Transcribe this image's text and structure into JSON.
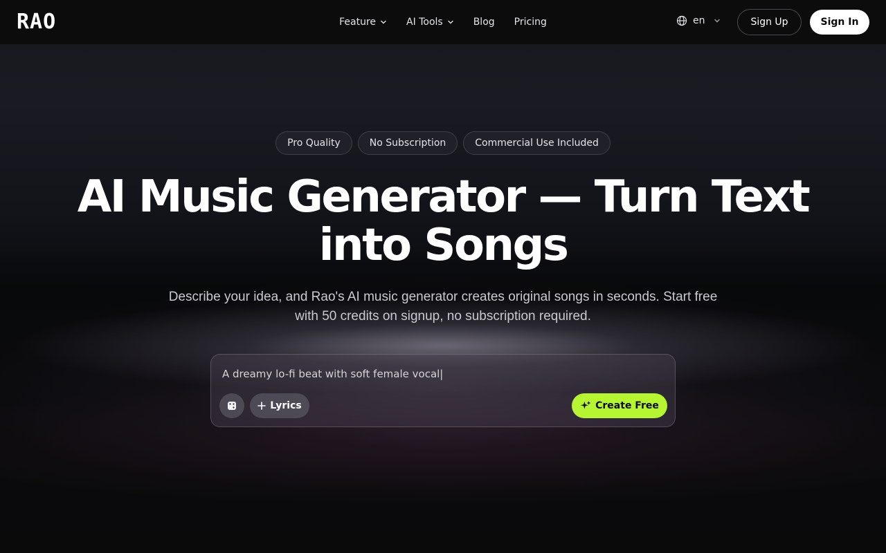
{
  "brand": {
    "logo": "RAO"
  },
  "nav": {
    "items": [
      {
        "label": "Feature",
        "has_dropdown": true
      },
      {
        "label": "AI Tools",
        "has_dropdown": true
      },
      {
        "label": "Blog",
        "has_dropdown": false
      },
      {
        "label": "Pricing",
        "has_dropdown": false
      }
    ]
  },
  "header": {
    "language": "en",
    "sign_up": "Sign Up",
    "sign_in": "Sign In"
  },
  "hero": {
    "badges": [
      "Pro Quality",
      "No Subscription",
      "Commercial Use Included"
    ],
    "title_line1": "AI Music Generator — Turn Text",
    "title_line2": "into Songs",
    "subtitle_line1": "Describe your idea, and Rao's AI music generator creates original songs in seconds. Start free",
    "subtitle_line2": "with 50 credits on signup, no subscription required."
  },
  "prompt": {
    "value": "A dreamy lo-fi beat with soft female vocal|",
    "lyrics_label": "Lyrics",
    "create_label": "Create Free"
  },
  "colors": {
    "accent": "#b5f532",
    "background": "#0a0a0b"
  },
  "icons": {
    "language": "globe-icon",
    "dropdown": "chevron-down-icon",
    "random": "dice-icon",
    "add": "plus-icon",
    "create": "sparkle-icon"
  }
}
